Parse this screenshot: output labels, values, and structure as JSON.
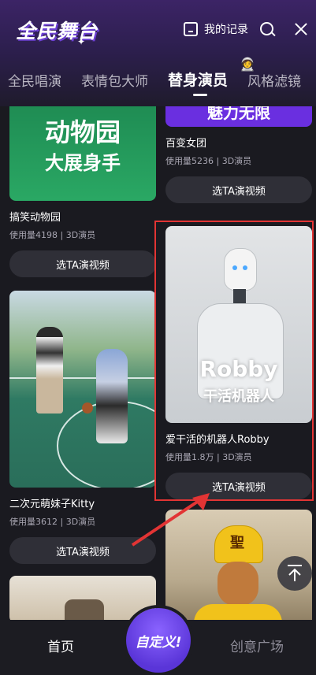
{
  "app": {
    "logo_text": "全民舞台",
    "my_records_label": "我的记录"
  },
  "tabs": [
    "全民唱演",
    "表情包大师",
    "替身演员",
    "风格滤镜"
  ],
  "cards": {
    "zoo": {
      "thumb_line1": "动物园",
      "thumb_line2": "大展身手",
      "title": "搞笑动物园",
      "meta": "使用量4198 | 3D演员",
      "button": "选TA演视频"
    },
    "girlgroup": {
      "thumb_text": "魅力无限",
      "title": "百变女团",
      "meta": "使用量5236 | 3D演员",
      "button": "选TA演视频"
    },
    "kitty": {
      "title": "二次元萌妹子Kitty",
      "meta": "使用量3612 | 3D演员",
      "button": "选TA演视频"
    },
    "robby": {
      "thumb_line1": "Robby",
      "thumb_line2": "干活机器人",
      "title": "爱干活的机器人Robby",
      "meta": "使用量1.8万 | 3D演员",
      "button": "选TA演视频"
    },
    "monkey": {
      "hat_char": "聖"
    }
  },
  "nav": {
    "home": "首页",
    "custom": "自定义!",
    "ideas": "创意广场"
  },
  "colors": {
    "header_purple": "#3c2466",
    "accent_purple": "#6b3fd1",
    "highlight_red": "#e23434",
    "card_button": "#2f2f37"
  },
  "icons": [
    "record-icon",
    "search-icon",
    "close-icon",
    "scroll-top-icon"
  ]
}
